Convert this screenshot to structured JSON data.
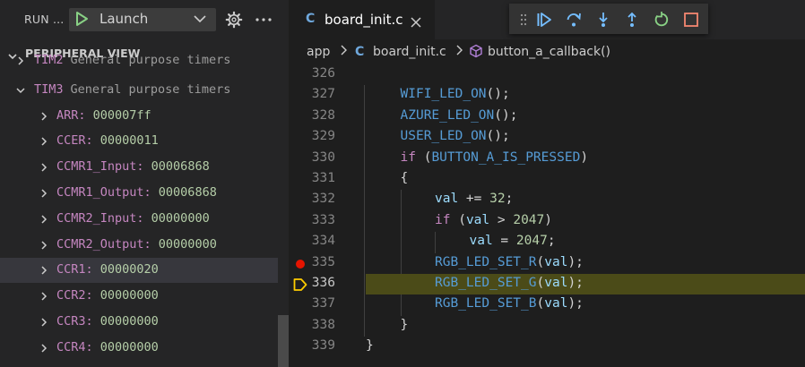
{
  "run_bar": {
    "title": "RUN ...",
    "config_name": "Launch",
    "icons": [
      "drag-grip-icon",
      "play-icon",
      "chevron-down-icon",
      "gear-icon",
      "more-icon"
    ]
  },
  "peripheral_view": {
    "title": "PERIPHERAL VIEW",
    "rows": [
      {
        "name": "TIM2",
        "desc": "General purpose timers",
        "indent": 0,
        "expanded": false,
        "partial": true
      },
      {
        "name": "TIM3",
        "desc": "General purpose timers",
        "indent": 0,
        "expanded": true
      },
      {
        "name": "ARR:",
        "value": "000007ff",
        "indent": 1
      },
      {
        "name": "CCER:",
        "value": "00000011",
        "indent": 1
      },
      {
        "name": "CCMR1_Input:",
        "value": "00006868",
        "indent": 1
      },
      {
        "name": "CCMR1_Output:",
        "value": "00006868",
        "indent": 1
      },
      {
        "name": "CCMR2_Input:",
        "value": "00000000",
        "indent": 1
      },
      {
        "name": "CCMR2_Output:",
        "value": "00000000",
        "indent": 1
      },
      {
        "name": "CCR1:",
        "value": "00000020",
        "indent": 1,
        "selected": true
      },
      {
        "name": "CCR2:",
        "value": "00000000",
        "indent": 1
      },
      {
        "name": "CCR3:",
        "value": "00000000",
        "indent": 1
      },
      {
        "name": "CCR4:",
        "value": "00000000",
        "indent": 1
      }
    ]
  },
  "tab": {
    "lang_icon": "C",
    "filename": "board_init.c",
    "close_icon": "close-icon"
  },
  "debug_toolbar": {
    "icons": [
      "drag-grip-icon",
      "continue-icon",
      "step-over-icon",
      "step-into-icon",
      "step-out-icon",
      "restart-icon",
      "stop-icon"
    ],
    "colors": {
      "blue": "#75beff",
      "green": "#89d185",
      "red": "#f48771"
    }
  },
  "breadcrumb": {
    "folder": "app",
    "lang_icon": "C",
    "file": "board_init.c",
    "symbol": "button_a_callback()"
  },
  "code": {
    "current_line": 336,
    "breakpoint_line": 335,
    "highlight_color": "#4b4b18",
    "lines": [
      {
        "num": "326",
        "indent": 0,
        "tokens": []
      },
      {
        "num": "327",
        "indent": 1,
        "tokens": [
          [
            "f",
            "WIFI_LED_ON"
          ],
          [
            "p",
            "();"
          ]
        ]
      },
      {
        "num": "328",
        "indent": 1,
        "tokens": [
          [
            "f",
            "AZURE_LED_ON"
          ],
          [
            "p",
            "();"
          ]
        ]
      },
      {
        "num": "329",
        "indent": 1,
        "tokens": [
          [
            "f",
            "USER_LED_ON"
          ],
          [
            "p",
            "();"
          ]
        ]
      },
      {
        "num": "330",
        "indent": 1,
        "tokens": [
          [
            "k",
            "if"
          ],
          [
            "p",
            " ("
          ],
          [
            "f",
            "BUTTON_A_IS_PRESSED"
          ],
          [
            "p",
            ")"
          ]
        ]
      },
      {
        "num": "331",
        "indent": 1,
        "tokens": [
          [
            "p",
            "{"
          ]
        ]
      },
      {
        "num": "332",
        "indent": 2,
        "tokens": [
          [
            "v",
            "val"
          ],
          [
            "p",
            " += "
          ],
          [
            "n",
            "32"
          ],
          [
            "p",
            ";"
          ]
        ]
      },
      {
        "num": "333",
        "indent": 2,
        "tokens": [
          [
            "k",
            "if"
          ],
          [
            "p",
            " ("
          ],
          [
            "v",
            "val"
          ],
          [
            "p",
            " > "
          ],
          [
            "n",
            "2047"
          ],
          [
            "p",
            ")"
          ]
        ]
      },
      {
        "num": "334",
        "indent": 3,
        "tokens": [
          [
            "v",
            "val"
          ],
          [
            "p",
            " = "
          ],
          [
            "n",
            "2047"
          ],
          [
            "p",
            ";"
          ]
        ]
      },
      {
        "num": "335",
        "indent": 2,
        "tokens": [
          [
            "f",
            "RGB_LED_SET_R"
          ],
          [
            "p",
            "("
          ],
          [
            "v",
            "val"
          ],
          [
            "p",
            ");"
          ]
        ]
      },
      {
        "num": "336",
        "indent": 2,
        "tokens": [
          [
            "f",
            "RGB_LED_SET_G"
          ],
          [
            "p",
            "("
          ],
          [
            "v",
            "val"
          ],
          [
            "p",
            ");"
          ]
        ]
      },
      {
        "num": "337",
        "indent": 2,
        "tokens": [
          [
            "f",
            "RGB_LED_SET_B"
          ],
          [
            "p",
            "("
          ],
          [
            "v",
            "val"
          ],
          [
            "p",
            ");"
          ]
        ]
      },
      {
        "num": "338",
        "indent": 1,
        "tokens": [
          [
            "p",
            "}"
          ]
        ]
      },
      {
        "num": "339",
        "indent": 0,
        "tokens": [
          [
            "p",
            "}"
          ]
        ]
      }
    ]
  }
}
